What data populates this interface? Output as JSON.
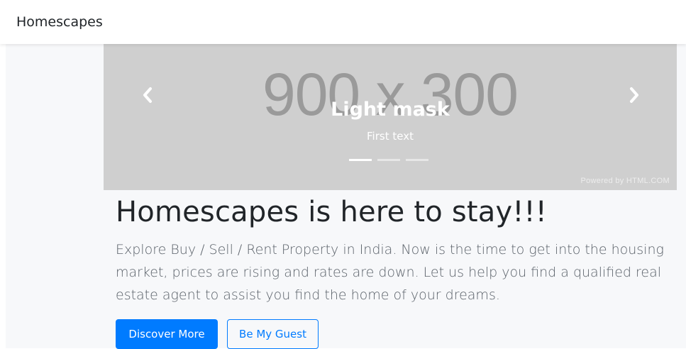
{
  "navbar": {
    "brand": "Homescapes"
  },
  "carousel": {
    "placeholder": "900 x 300",
    "caption_title": "Light mask",
    "caption_text": "First text",
    "powered_by": "Powered by HTML.COM",
    "slide_count": 3,
    "active_slide": 1,
    "background_color": "#cfcfcf"
  },
  "hero": {
    "headline": "Homescapes is here to stay!!!",
    "lead": "Explore Buy / Sell / Rent Property in India. Now is the time to get into the housing market, prices are rising and rates are down. Let us help you find a qualified real estate agent to assist you find the home of your dreams."
  },
  "buttons": {
    "primary_label": "Discover More",
    "secondary_label": "Be My Guest",
    "accent_color": "#007bff"
  }
}
